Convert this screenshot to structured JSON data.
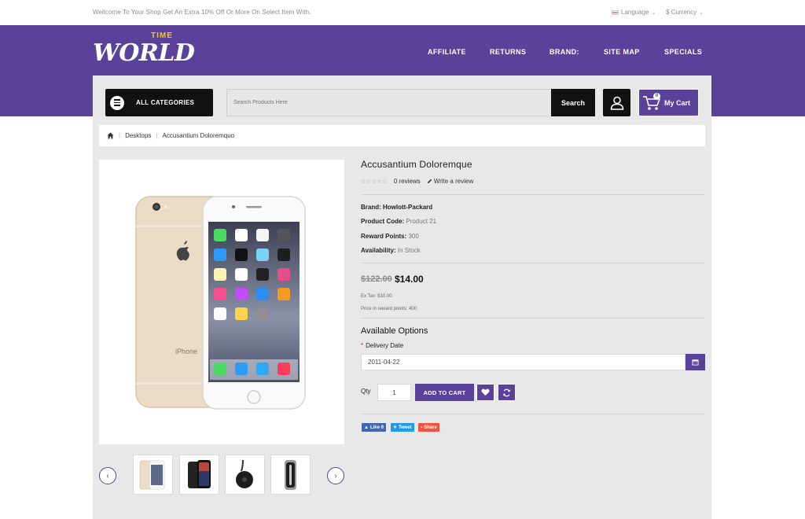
{
  "topbar": {
    "welcome": "Wellcome To Your Shop Get An Extra 10% Off Or More On Select Item With.",
    "language": "Language",
    "currency": "$ Currency"
  },
  "logo": {
    "top": "TIME",
    "word": "WORLD"
  },
  "nav": [
    "AFFILIATE",
    "RETURNS",
    "BRAND:",
    "SITE MAP",
    "SPECIALS"
  ],
  "search": {
    "categories_label": "ALL CATEGORIES",
    "placeholder": "Search Products Here",
    "button": "Search"
  },
  "cart": {
    "label": "My Cart",
    "count": "0"
  },
  "breadcrumb": [
    "Desktops",
    "Accusantium Doloremquo"
  ],
  "product": {
    "name": "Accusantium Doloremque",
    "reviews": "0 reviews",
    "write_review": "Write a review",
    "specs": [
      {
        "label": "Brand:",
        "value": "Howlott-Packard"
      },
      {
        "label": "Product Code:",
        "value": "Product 21"
      },
      {
        "label": "Reward Points:",
        "value": "300"
      },
      {
        "label": "Availability:",
        "value": "In Stock"
      }
    ],
    "old_price": "$122.00",
    "new_price": "$14.00",
    "ex_tax": "Ex Tax: $10.00",
    "reward_price": "Price in reward points: 400"
  },
  "options": {
    "title": "Available Options",
    "delivery_label": "Delivery Date",
    "delivery_value": "2011-04-22",
    "qty_label": "Qty",
    "qty_value": "1",
    "add_to_cart": "ADD TO CART"
  },
  "share": {
    "like": "Like 0",
    "tweet": "Tweet",
    "share": "Share"
  },
  "colors": {
    "brand": "#5a4199",
    "dark": "#111111",
    "gold": "#f2c230"
  }
}
